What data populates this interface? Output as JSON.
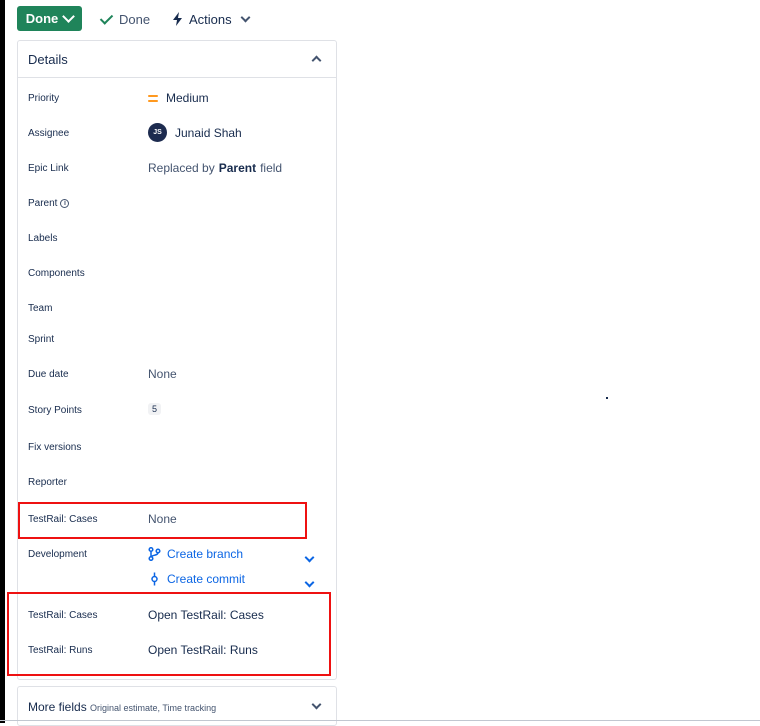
{
  "toolbar": {
    "done_button": "Done",
    "status_label": "Done",
    "actions_label": "Actions"
  },
  "details": {
    "title": "Details",
    "fields": {
      "priority": {
        "label": "Priority",
        "value": "Medium"
      },
      "assignee": {
        "label": "Assignee",
        "value": "Junaid Shah",
        "initials": "JS"
      },
      "epic_link": {
        "label": "Epic Link",
        "prefix": "Replaced by",
        "bold": "Parent",
        "suffix": "field"
      },
      "parent": {
        "label": "Parent"
      },
      "labels": {
        "label": "Labels"
      },
      "components": {
        "label": "Components"
      },
      "team": {
        "label": "Team"
      },
      "sprint": {
        "label": "Sprint"
      },
      "due_date": {
        "label": "Due date",
        "value": "None"
      },
      "story_points": {
        "label": "Story Points",
        "value": "5"
      },
      "fix_versions": {
        "label": "Fix versions"
      },
      "reporter": {
        "label": "Reporter"
      },
      "testrail_cases_1": {
        "label": "TestRail: Cases",
        "value": "None"
      },
      "development": {
        "label": "Development",
        "create_branch": "Create branch",
        "create_commit": "Create commit"
      },
      "testrail_cases_2": {
        "label": "TestRail: Cases",
        "value": "Open TestRail: Cases"
      },
      "testrail_runs": {
        "label": "TestRail: Runs",
        "value": "Open TestRail: Runs"
      }
    }
  },
  "more_fields": {
    "title": "More fields",
    "subtitle": "Original estimate, Time tracking"
  },
  "colors": {
    "done_button": "#1f845a",
    "link": "#0c66e4",
    "priority_medium": "#ff991f",
    "highlight_box": "#e11"
  }
}
